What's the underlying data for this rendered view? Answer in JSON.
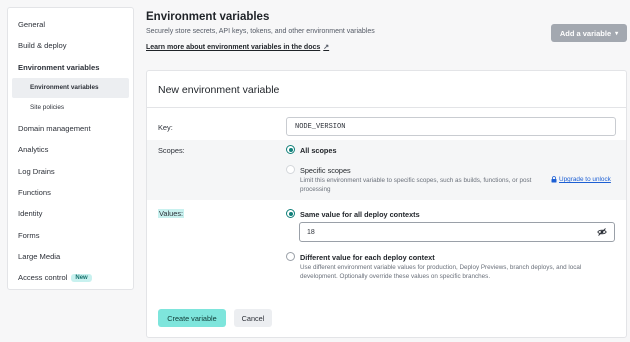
{
  "sidebar": {
    "items": [
      {
        "label": "General"
      },
      {
        "label": "Build & deploy"
      },
      {
        "label": "Environment variables"
      },
      {
        "label": "Environment variables"
      },
      {
        "label": "Site policies"
      },
      {
        "label": "Domain management"
      },
      {
        "label": "Analytics"
      },
      {
        "label": "Log Drains"
      },
      {
        "label": "Functions"
      },
      {
        "label": "Identity"
      },
      {
        "label": "Forms"
      },
      {
        "label": "Large Media"
      },
      {
        "label": "Access control",
        "badge": "New"
      }
    ]
  },
  "header": {
    "title": "Environment variables",
    "subtitle": "Securely store secrets, API keys, tokens, and other environment variables",
    "link": "Learn more about environment variables in the docs",
    "link_icon": "external-arrow-icon",
    "add_button": "Add a variable"
  },
  "form": {
    "title": "New environment variable",
    "key_label": "Key:",
    "key_value": "NODE_VERSION",
    "scopes_label": "Scopes:",
    "scope_all": "All scopes",
    "scope_specific": "Specific scopes",
    "scope_specific_desc": "Limit this environment variable to specific scopes, such as builds, functions, or post processing",
    "upgrade_link": "Upgrade to unlock",
    "values_label": "Values:",
    "value_same": "Same value for all deploy contexts",
    "value_input": "18",
    "value_different": "Different value for each deploy context",
    "value_different_desc": "Use different environment variable values for production, Deploy Previews, branch deploys, and local development. Optionally override these values on specific branches.",
    "create_button": "Create variable",
    "cancel_button": "Cancel"
  },
  "colors": {
    "accent": "#7ee5dc",
    "radio_checked": "#12807a",
    "link_blue": "#1c5fd4",
    "disabled_button": "#a3a8b0"
  }
}
